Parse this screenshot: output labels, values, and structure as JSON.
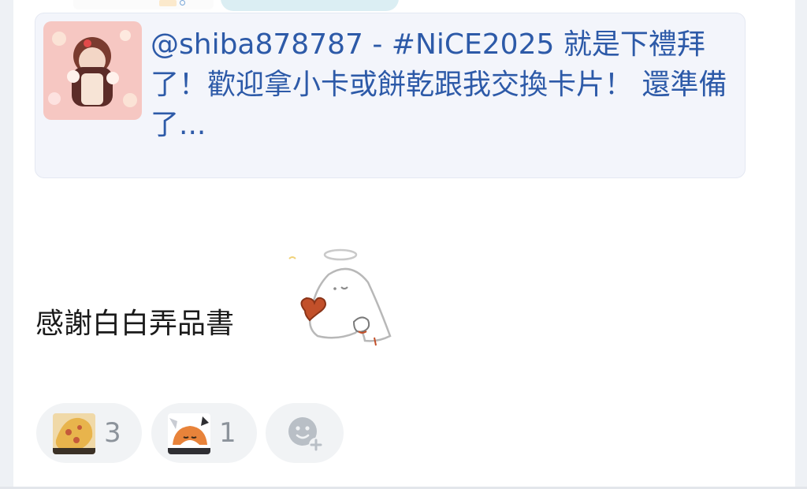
{
  "embed": {
    "text": "@shiba878787 - #NiCE2025 就是下禮拜了！歡迎拿小卡或餅乾跟我交換卡片！ 還準備了..."
  },
  "message": {
    "text": "感謝白白弄品書"
  },
  "reactions": [
    {
      "count": "3",
      "icon": "cookie-emoji"
    },
    {
      "count": "1",
      "icon": "fox-emoji"
    }
  ],
  "add_reaction": {
    "icon": "add-reaction-icon"
  },
  "colors": {
    "link": "#2d5aa8",
    "card_bg": "#f3f5fb",
    "chip_bg": "#f1f3f5",
    "count": "#8c939b"
  }
}
